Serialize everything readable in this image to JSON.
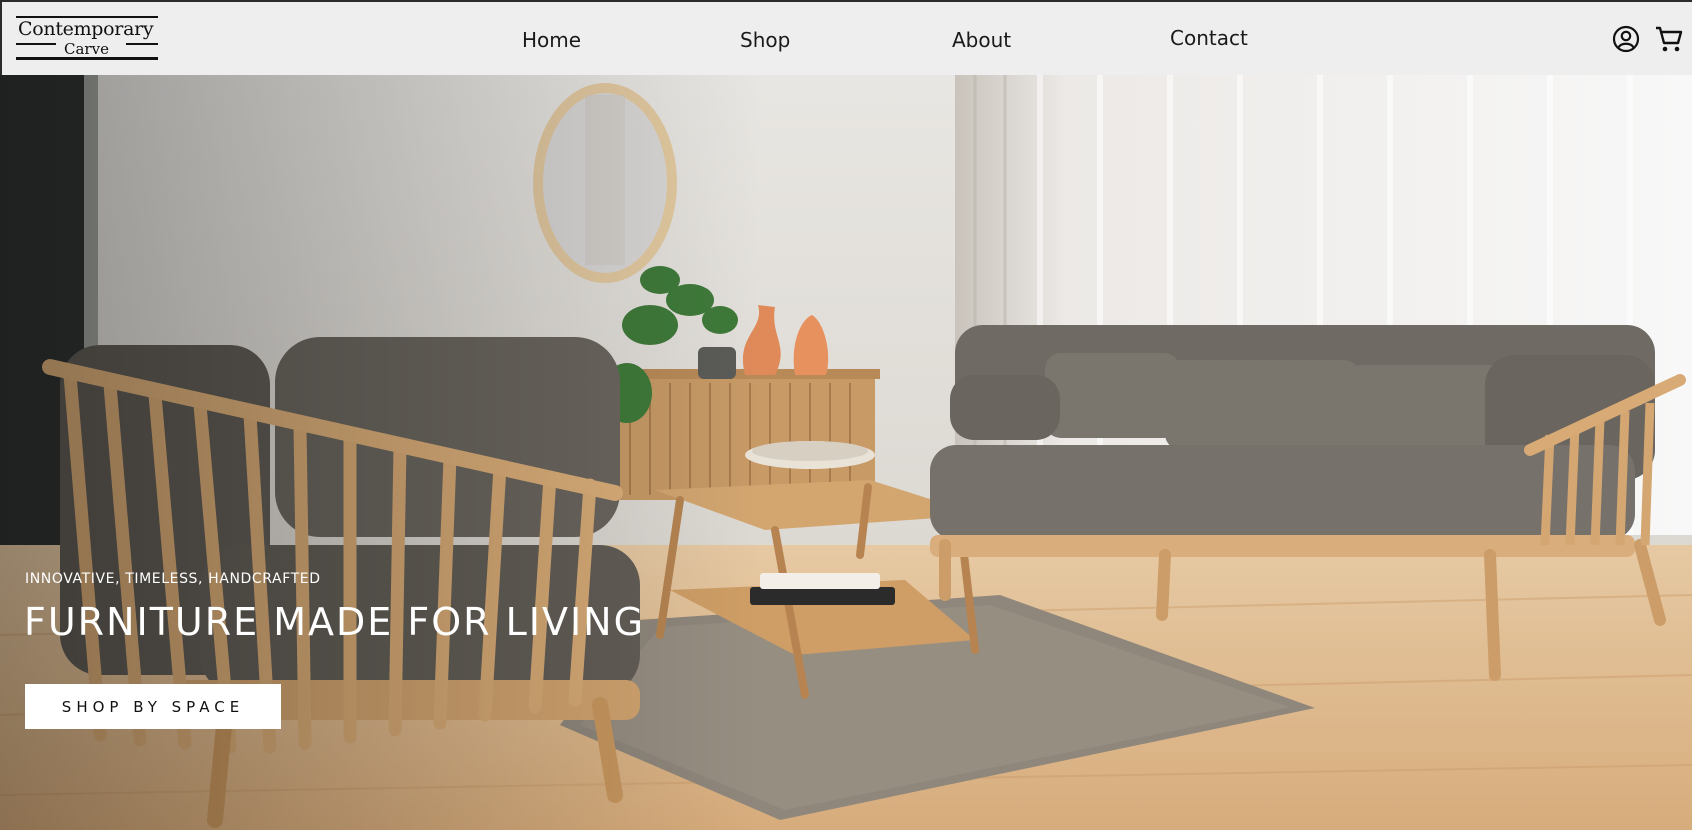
{
  "brand": {
    "line1": "Contemporary",
    "line2": "Carve"
  },
  "nav": {
    "home": "Home",
    "shop": "Shop",
    "about": "About",
    "contact": "Contact"
  },
  "header_icons": [
    "account-icon",
    "cart-icon"
  ],
  "hero": {
    "tagline": "INNOVATIVE, TIMELESS,  HANDCRAFTED",
    "headline": "FURNITURE MADE FOR LIVING",
    "cta_label": "SHOP BY SPACE"
  },
  "colors": {
    "header_bg": "#eeeeee",
    "text_dark": "#1a1a1a",
    "hero_text": "#ffffff",
    "cta_bg": "#ffffff"
  }
}
